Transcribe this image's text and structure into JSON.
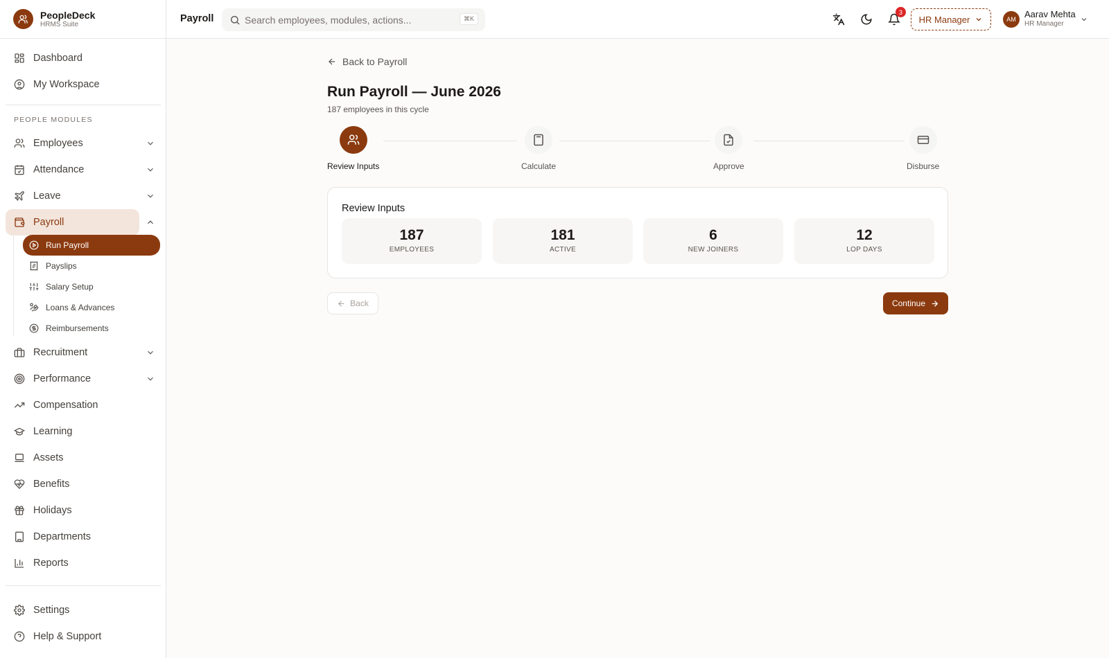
{
  "brand": {
    "name": "PeopleDeck",
    "subtitle": "HRMS Suite"
  },
  "sidebar": {
    "top_items": [
      {
        "label": "Dashboard",
        "icon": "grid-icon"
      },
      {
        "label": "My Workspace",
        "icon": "user-circle-icon"
      }
    ],
    "section_label": "PEOPLE MODULES",
    "modules": [
      {
        "label": "Employees",
        "icon": "users-icon"
      },
      {
        "label": "Attendance",
        "icon": "calendar-check-icon"
      },
      {
        "label": "Leave",
        "icon": "plane-icon"
      },
      {
        "label": "Payroll",
        "icon": "wallet-icon"
      },
      {
        "label": "Recruitment",
        "icon": "briefcase-icon"
      },
      {
        "label": "Performance",
        "icon": "target-icon"
      },
      {
        "label": "Compensation",
        "icon": "trending-up-icon"
      },
      {
        "label": "Learning",
        "icon": "graduation-cap-icon"
      },
      {
        "label": "Assets",
        "icon": "laptop-icon"
      },
      {
        "label": "Benefits",
        "icon": "heart-pulse-icon"
      },
      {
        "label": "Holidays",
        "icon": "gift-icon"
      },
      {
        "label": "Departments",
        "icon": "building-icon"
      },
      {
        "label": "Reports",
        "icon": "bar-chart-icon"
      }
    ],
    "payroll_sub": [
      {
        "label": "Run Payroll",
        "icon": "play-circle-icon"
      },
      {
        "label": "Payslips",
        "icon": "receipt-icon"
      },
      {
        "label": "Salary Setup",
        "icon": "sliders-icon"
      },
      {
        "label": "Loans & Advances",
        "icon": "hand-coins-icon"
      },
      {
        "label": "Reimbursements",
        "icon": "badge-dollar-icon"
      }
    ],
    "bottom_items": [
      {
        "label": "Settings",
        "icon": "gear-icon"
      },
      {
        "label": "Help & Support",
        "icon": "help-circle-icon"
      }
    ]
  },
  "topbar": {
    "page": "Payroll",
    "search_placeholder": "Search employees, modules, actions...",
    "shortcut": "⌘K",
    "notification_count": "3",
    "role": "HR Manager",
    "user": {
      "initials": "AM",
      "name": "Aarav Mehta",
      "role": "HR Manager"
    }
  },
  "main": {
    "back_link": "Back to Payroll",
    "title": "Run Payroll — June 2026",
    "subtitle": "187 employees in this cycle",
    "steps": [
      {
        "label": "Review Inputs",
        "icon": "users-icon"
      },
      {
        "label": "Calculate",
        "icon": "calculator-icon"
      },
      {
        "label": "Approve",
        "icon": "file-check-icon"
      },
      {
        "label": "Disburse",
        "icon": "credit-card-icon"
      }
    ],
    "active_step": 1,
    "card": {
      "title": "Review Inputs",
      "stats": [
        {
          "value": "187",
          "label": "EMPLOYEES"
        },
        {
          "value": "181",
          "label": "ACTIVE"
        },
        {
          "value": "6",
          "label": "NEW JOINERS"
        },
        {
          "value": "12",
          "label": "LOP DAYS"
        }
      ]
    },
    "back_button": "Back",
    "continue_button": "Continue"
  },
  "colors": {
    "accent": "#8b3a0f",
    "accent_light": "#f3e5dc",
    "badge": "#dc2626"
  }
}
